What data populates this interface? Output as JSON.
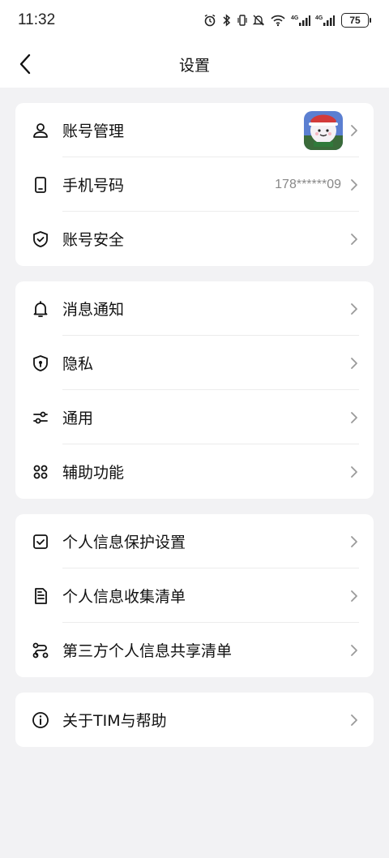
{
  "status_bar": {
    "time": "11:32",
    "network_1": "4G",
    "network_2": "4G",
    "battery": "75"
  },
  "nav": {
    "title": "设置"
  },
  "groups": [
    {
      "items": [
        {
          "label": "账号管理",
          "icon": "user-icon"
        },
        {
          "label": "手机号码",
          "value": "178******09",
          "icon": "phone-icon"
        },
        {
          "label": "账号安全",
          "icon": "shield-check-icon"
        }
      ]
    },
    {
      "items": [
        {
          "label": "消息通知",
          "icon": "bell-icon"
        },
        {
          "label": "隐私",
          "icon": "privacy-shield-icon"
        },
        {
          "label": "通用",
          "icon": "sliders-icon"
        },
        {
          "label": "辅助功能",
          "icon": "command-icon"
        }
      ]
    },
    {
      "items": [
        {
          "label": "个人信息保护设置",
          "icon": "checkbox-icon"
        },
        {
          "label": "个人信息收集清单",
          "icon": "document-list-icon"
        },
        {
          "label": "第三方个人信息共享清单",
          "icon": "share-nodes-icon"
        }
      ]
    },
    {
      "items": [
        {
          "label": "关于TIM与帮助",
          "icon": "info-icon"
        }
      ]
    }
  ],
  "colors": {
    "background": "#f2f2f4",
    "card": "#ffffff",
    "text": "#111111",
    "secondary_text": "#888888",
    "chevron": "#9a9a9a"
  }
}
